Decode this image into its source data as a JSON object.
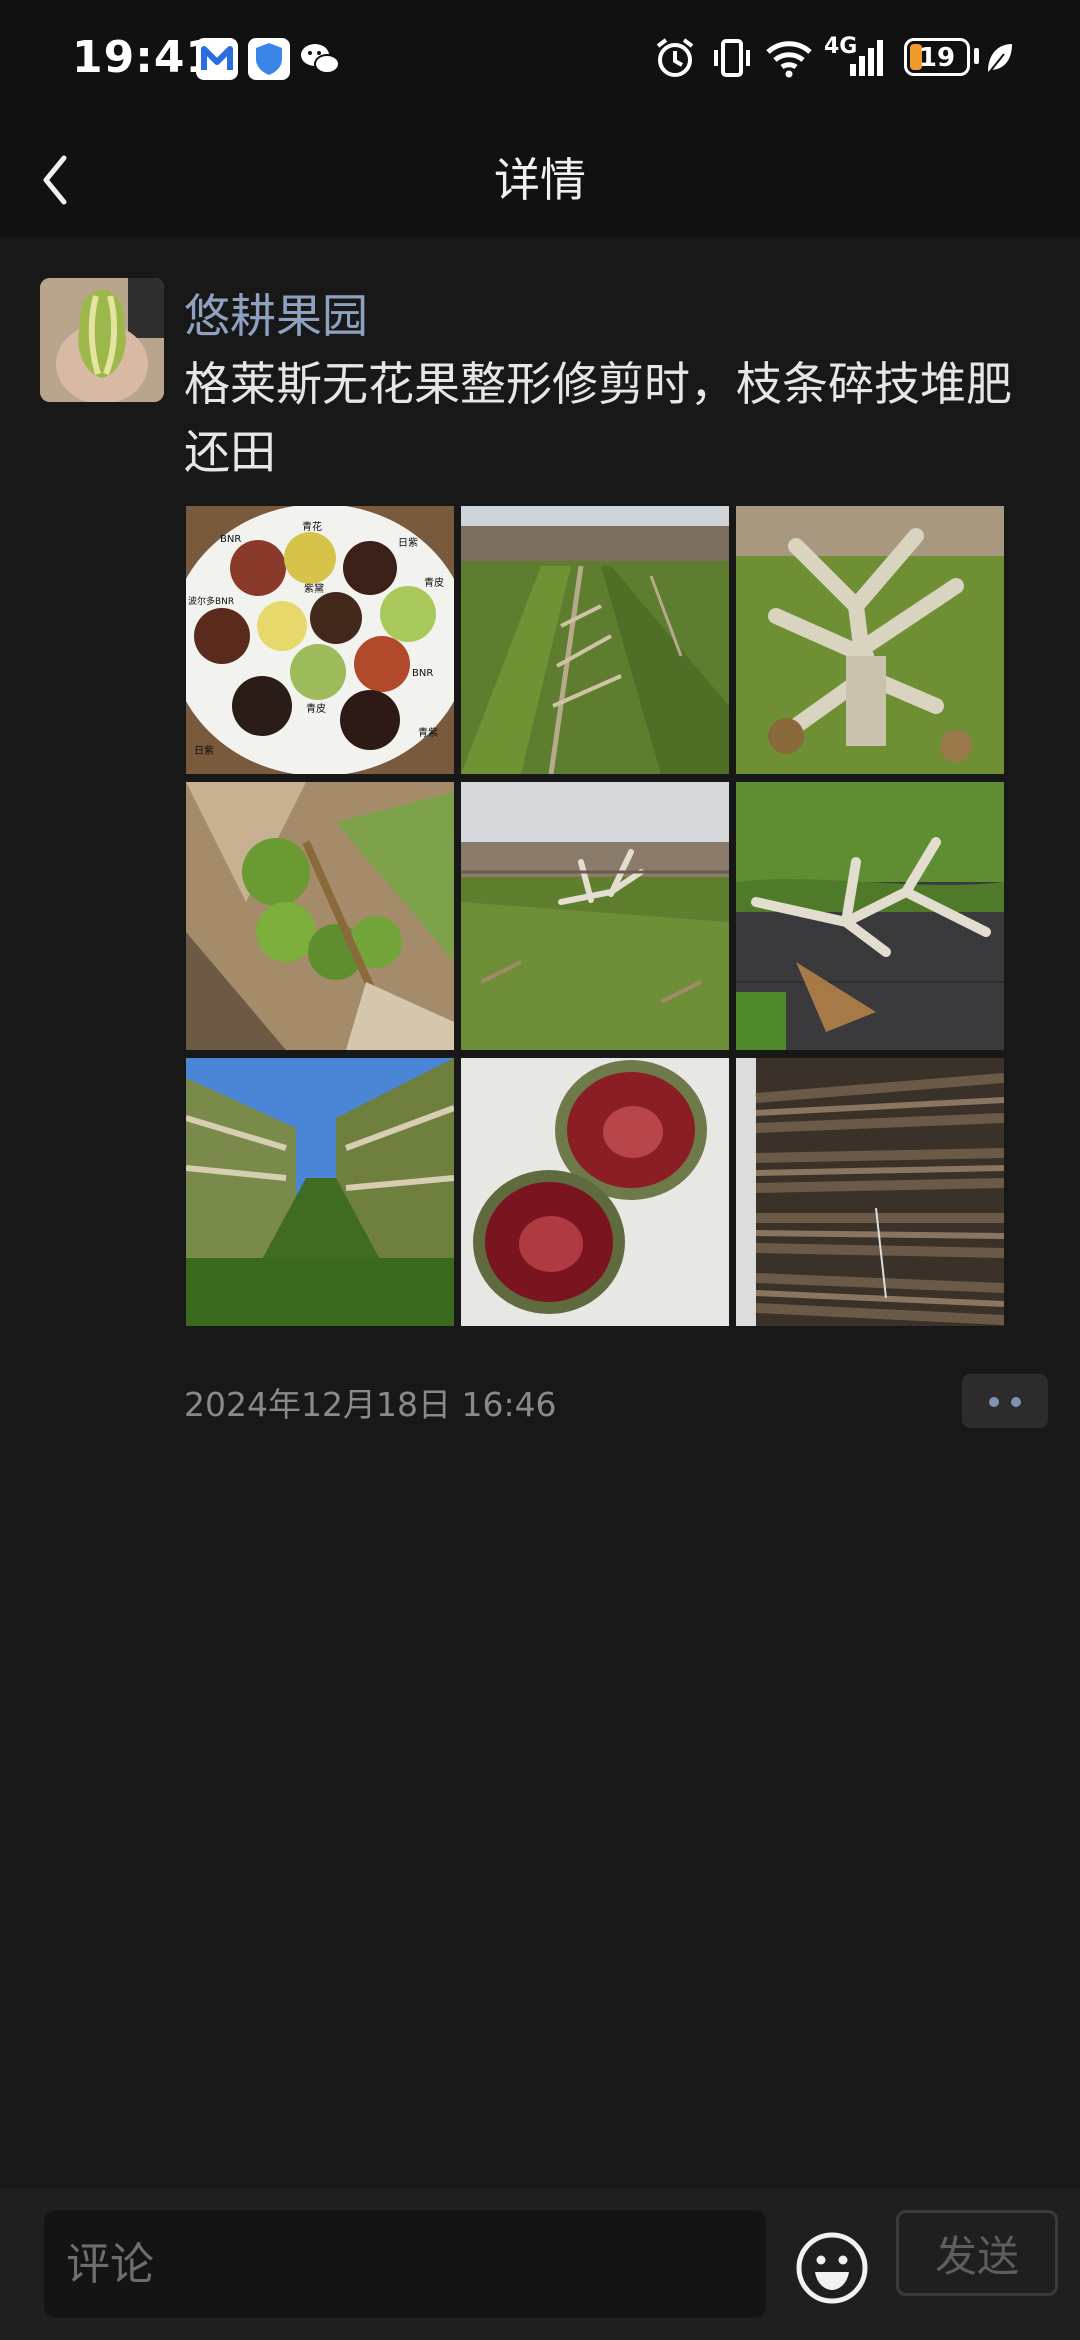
{
  "status_bar": {
    "time": "19:41",
    "network": "4G",
    "battery": "19",
    "icons": [
      "app-m-icon",
      "shield-icon",
      "wechat-icon",
      "alarm-icon",
      "vibrate-icon",
      "wifi-icon",
      "signal-icon",
      "battery-icon",
      "leaf-icon"
    ]
  },
  "nav": {
    "title": "详情",
    "back_icon": "chevron-left-icon"
  },
  "post": {
    "username": "悠耕果园",
    "text": "格莱斯无花果整形修剪时，枝条碎技堆肥还田",
    "images": [
      {
        "label": "fig-varieties-plate",
        "tags": [
          "BNR",
          "青花",
          "日紫",
          "青皮",
          "波尔多BNR",
          "紫黛",
          "BNR",
          "日紫",
          "青皮",
          "青紫"
        ]
      },
      {
        "label": "pruned-orchard-rows"
      },
      {
        "label": "pruned-fig-tree-closeup"
      },
      {
        "label": "green-figs-on-branch"
      },
      {
        "label": "orchard-after-pruning"
      },
      {
        "label": "pruned-branches-on-ground"
      },
      {
        "label": "fig-trees-blue-sky"
      },
      {
        "label": "cut-fig-halves"
      },
      {
        "label": "bundled-cut-branches"
      }
    ],
    "timestamp": "2024年12月18日 16:46",
    "more_icon": "more-dots-icon"
  },
  "comment_bar": {
    "placeholder": "评论",
    "value": "",
    "emoji_icon": "emoji-icon",
    "send_label": "发送"
  },
  "colors": {
    "background": "#181818",
    "bar": "#111111",
    "username": "#8fa1c0",
    "battery": "#f29b2c"
  }
}
